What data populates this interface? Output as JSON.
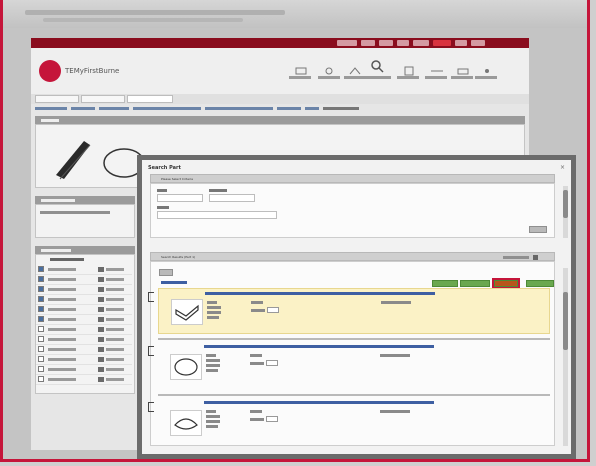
{
  "app": {
    "site_name": "TEMyFirstBurne",
    "frame_color": "#c5153a"
  },
  "dialog": {
    "title": "Search Part",
    "close_glyph": "×",
    "filter_section": {
      "heading": "Please Select Criteria"
    },
    "results_section": {
      "heading": "Search Results (Part 1)"
    }
  },
  "colors": {
    "accent": "#c5153a",
    "green_button": "#6aa84f",
    "selected_button": "#b8561b",
    "highlight_row": "#fbf2c6"
  },
  "icons": [
    "search-icon",
    "close-icon",
    "thumb-belt-icon",
    "thumb-oring-icon",
    "thumb-gasket-icon"
  ]
}
